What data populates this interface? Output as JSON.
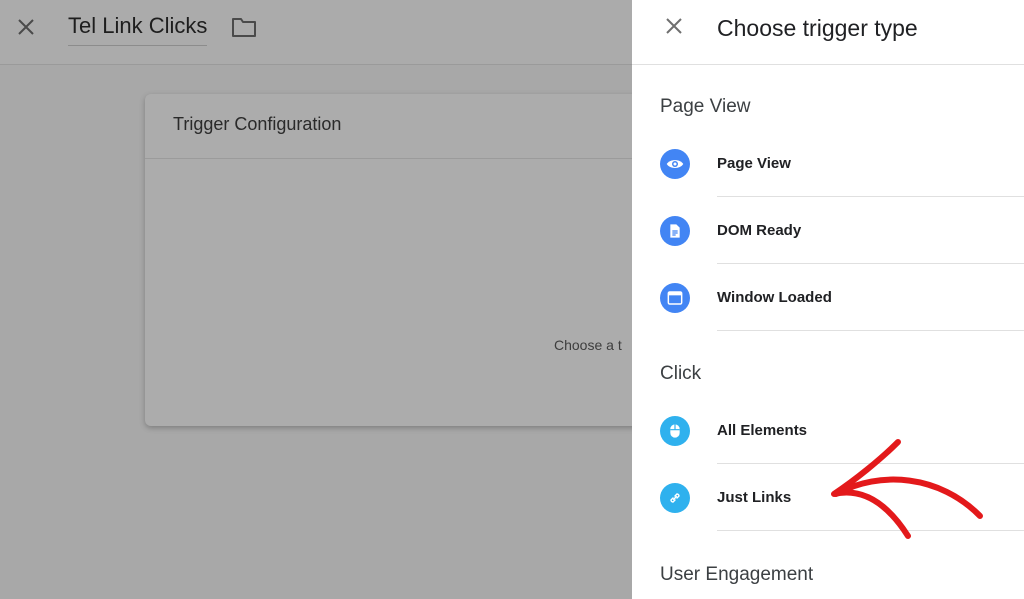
{
  "editor": {
    "title": "Tel Link Clicks",
    "card_title": "Trigger Configuration",
    "card_hint": "Choose a t"
  },
  "drawer": {
    "heading": "Choose trigger type",
    "sections": {
      "page_view": {
        "title": "Page View",
        "items": [
          {
            "label": "Page View",
            "icon": "eye-icon"
          },
          {
            "label": "DOM Ready",
            "icon": "document-icon"
          },
          {
            "label": "Window Loaded",
            "icon": "window-icon"
          }
        ]
      },
      "click": {
        "title": "Click",
        "items": [
          {
            "label": "All Elements",
            "icon": "mouse-icon"
          },
          {
            "label": "Just Links",
            "icon": "link-icon"
          }
        ]
      },
      "user_engagement": {
        "title": "User Engagement"
      }
    }
  },
  "colors": {
    "accent_blue": "#4285f4",
    "accent_light_blue": "#2fb1ee",
    "annotation_red": "#e3191b"
  }
}
